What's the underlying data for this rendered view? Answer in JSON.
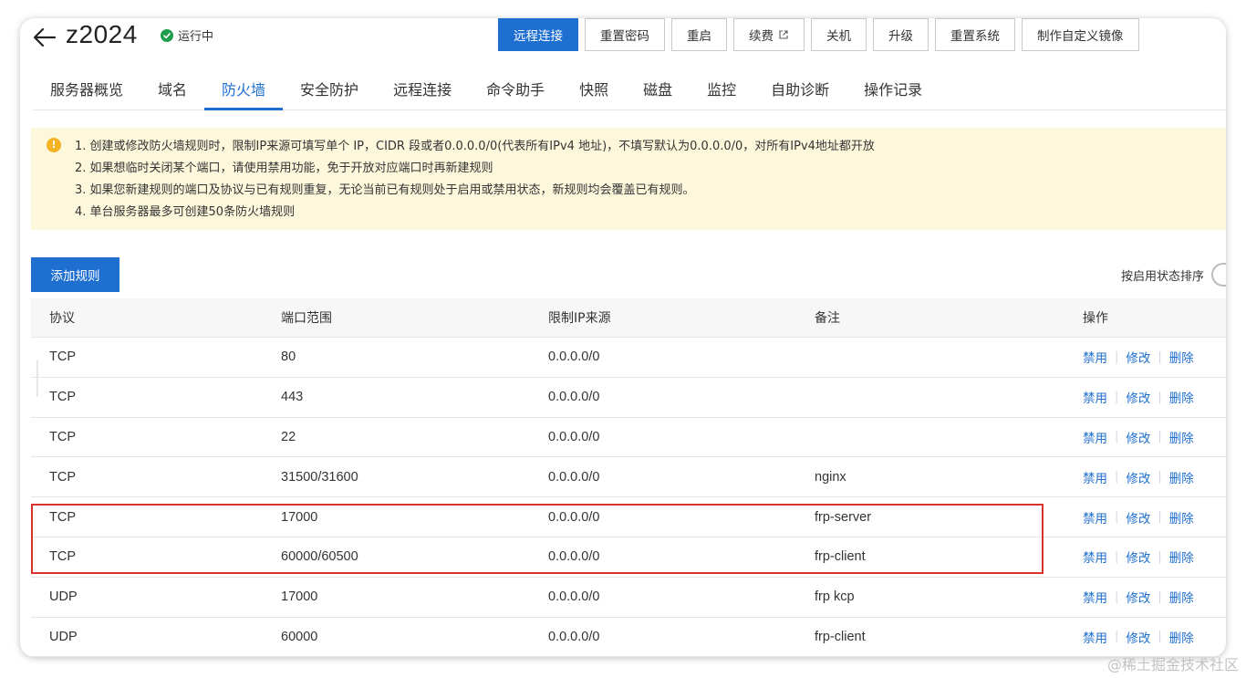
{
  "header": {
    "title": "z2024",
    "status": "运行中",
    "status_color": "#1f9f4d",
    "buttons": [
      "远程连接",
      "重置密码",
      "重启",
      "续费",
      "关机",
      "升级",
      "重置系统",
      "制作自定义镜像"
    ]
  },
  "tabs": [
    "服务器概览",
    "域名",
    "防火墙",
    "安全防护",
    "远程连接",
    "命令助手",
    "快照",
    "磁盘",
    "监控",
    "自助诊断",
    "操作记录"
  ],
  "active_tab": "防火墙",
  "notice": {
    "lines": [
      "1. 创建或修改防火墙规则时，限制IP来源可填写单个 IP，CIDR 段或者0.0.0.0/0(代表所有IPv4 地址)，不填写默认为0.0.0.0/0，对所有IPv4地址都开放",
      "2. 如果想临时关闭某个端口，请使用禁用功能，免于开放对应端口时再新建规则",
      "3. 如果您新建规则的端口及协议与已有规则重复，无论当前已有规则处于启用或禁用状态，新规则均会覆盖已有规则。",
      "4. 单台服务器最多可创建50条防火墙规则"
    ]
  },
  "actions": {
    "add_rule": "添加规则",
    "sort_label": "按启用状态排序"
  },
  "table": {
    "headers": [
      "协议",
      "端口范围",
      "限制IP来源",
      "备注",
      "操作"
    ],
    "row_actions": [
      "禁用",
      "修改",
      "删除"
    ],
    "rows": [
      {
        "protocol": "TCP",
        "port": "80",
        "source": "0.0.0.0/0",
        "note": ""
      },
      {
        "protocol": "TCP",
        "port": "443",
        "source": "0.0.0.0/0",
        "note": ""
      },
      {
        "protocol": "TCP",
        "port": "22",
        "source": "0.0.0.0/0",
        "note": ""
      },
      {
        "protocol": "TCP",
        "port": "31500/31600",
        "source": "0.0.0.0/0",
        "note": "nginx"
      },
      {
        "protocol": "TCP",
        "port": "17000",
        "source": "0.0.0.0/0",
        "note": "frp-server"
      },
      {
        "protocol": "TCP",
        "port": "60000/60500",
        "source": "0.0.0.0/0",
        "note": "frp-client"
      },
      {
        "protocol": "UDP",
        "port": "17000",
        "source": "0.0.0.0/0",
        "note": "frp kcp"
      },
      {
        "protocol": "UDP",
        "port": "60000",
        "source": "0.0.0.0/0",
        "note": "frp-client"
      }
    ]
  },
  "watermark": "@稀土掘金技术社区",
  "colors": {
    "accent": "#1f6fd1",
    "notice_bg": "#fdf8dc",
    "highlight_border": "#d9312b"
  }
}
